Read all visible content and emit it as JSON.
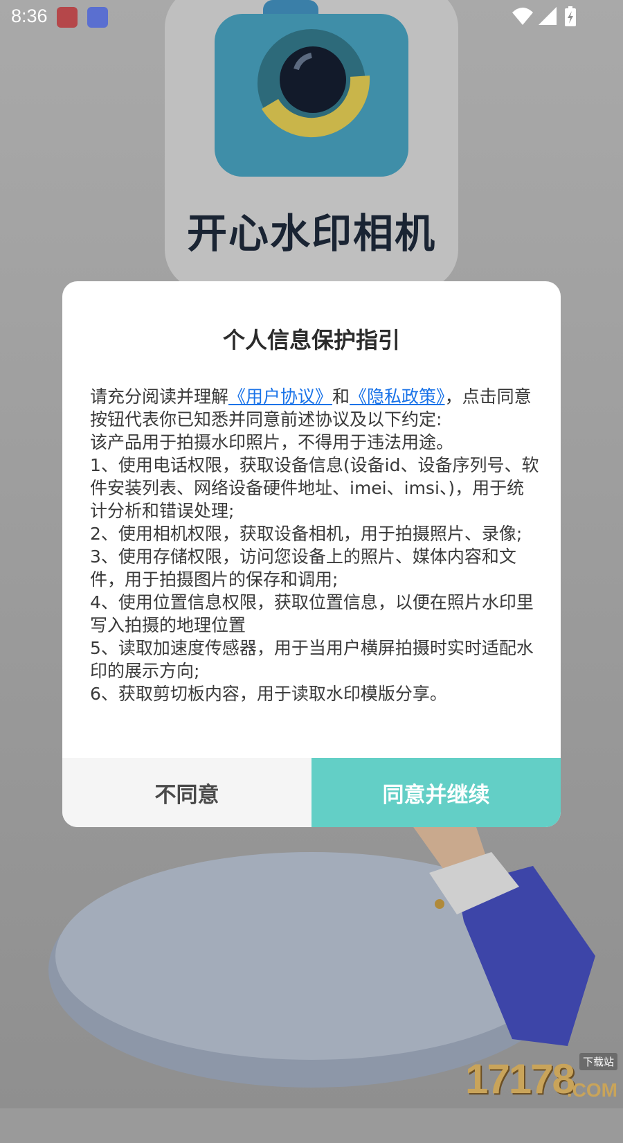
{
  "status_bar": {
    "time": "8:36"
  },
  "app_splash": {
    "name": "开心水印相机"
  },
  "dialog": {
    "title": "个人信息保护指引",
    "intro_prefix": "请充分阅读并理解",
    "user_agreement_link": "《用户协议》",
    "intro_and": "和",
    "privacy_policy_link": "《隐私政策》",
    "intro_suffix": "，点击同意按钮代表你已知悉并同意前述协议及以下约定:",
    "purpose": "该产品用于拍摄水印照片，不得用于违法用途。",
    "items": [
      "1、使用电话权限，获取设备信息(设备id、设备序列号、软件安装列表、网络设备硬件地址、imei、imsi、)，用于统计分析和错误处理;",
      "2、使用相机权限，获取设备相机，用于拍摄照片、录像;",
      "3、使用存储权限，访问您设备上的照片、媒体内容和文件，用于拍摄图片的保存和调用;",
      "4、使用位置信息权限，获取位置信息，以便在照片水印里写入拍摄的地理位置",
      "5、读取加速度传感器，用于当用户横屏拍摄时实时适配水印的展示方向;",
      "6、获取剪切板内容，用于读取水印模版分享。"
    ],
    "disagree_label": "不同意",
    "agree_label": "同意并继续"
  },
  "watermark": {
    "number": "17178",
    "tag": "下载站",
    "suffix": ".COM"
  },
  "colors": {
    "agree_button": "#63cfc6",
    "link": "#1a73e8",
    "disagree_button": "#f5f5f5"
  }
}
